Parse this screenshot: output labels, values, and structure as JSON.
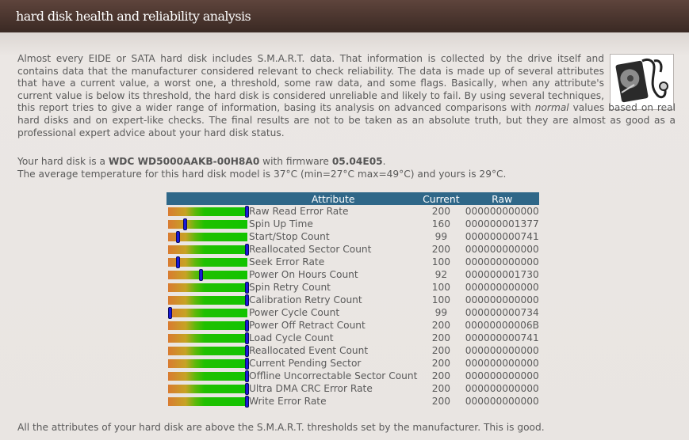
{
  "header": {
    "title": "hard disk health and reliability analysis"
  },
  "intro": {
    "text_before": "Almost every EIDE or SATA hard disk includes S.M.A.R.T. data. That information is collected by the drive itself and contains data that the manufacturer considered relevant to check reliability. The data is made up of several attributes that have a current value, a worst one, a threshold, some raw data, and some flags. Basically, when any attribute's current value is below its threshold, the hard disk is considered unreliable and likely to fail. By using several techniques, this report tries to give a wider range of information, basing its analysis on advanced comparisons with ",
    "emphasis": "normal",
    "text_after": " values based on real hard disks and on expert-like checks. The final results are not to be taken as an absolute truth, but they are almost as good as a professional expert advice about your hard disk status."
  },
  "disk": {
    "line1_prefix": "Your hard disk is a ",
    "model": "WDC WD5000AAKB-00H8A0",
    "line1_mid": " with firmware ",
    "firmware": "05.04E05",
    "line1_suffix": ".",
    "temp_line": "The average temperature for this hard disk model is 37°C (min=27°C max=49°C) and yours is 29°C."
  },
  "table": {
    "headers": {
      "attribute": "Attribute",
      "current": "Current",
      "raw": "Raw"
    },
    "rows": [
      {
        "name": "Raw Read Error Rate",
        "current": "200",
        "raw": "000000000000",
        "level": 1.0
      },
      {
        "name": "Spin Up Time",
        "current": "160",
        "raw": "000000001377",
        "level": 0.2
      },
      {
        "name": "Start/Stop Count",
        "current": "99",
        "raw": "000000000741",
        "level": 0.1
      },
      {
        "name": "Reallocated Sector Count",
        "current": "200",
        "raw": "000000000000",
        "level": 1.0
      },
      {
        "name": "Seek Error Rate",
        "current": "100",
        "raw": "000000000000",
        "level": 0.1
      },
      {
        "name": "Power On Hours Count",
        "current": "92",
        "raw": "000000001730",
        "level": 0.4
      },
      {
        "name": "Spin Retry Count",
        "current": "100",
        "raw": "000000000000",
        "level": 1.0
      },
      {
        "name": "Calibration Retry Count",
        "current": "100",
        "raw": "000000000000",
        "level": 1.0
      },
      {
        "name": "Power Cycle Count",
        "current": "99",
        "raw": "000000000734",
        "level": 0.0
      },
      {
        "name": "Power Off Retract Count",
        "current": "200",
        "raw": "00000000006B",
        "level": 1.0
      },
      {
        "name": "Load Cycle Count",
        "current": "200",
        "raw": "000000000741",
        "level": 1.0
      },
      {
        "name": "Reallocated Event Count",
        "current": "200",
        "raw": "000000000000",
        "level": 1.0
      },
      {
        "name": "Current Pending Sector",
        "current": "200",
        "raw": "000000000000",
        "level": 1.0
      },
      {
        "name": "Offline Uncorrectable Sector Count",
        "current": "200",
        "raw": "000000000000",
        "level": 1.0
      },
      {
        "name": "Ultra DMA CRC Error Rate",
        "current": "200",
        "raw": "000000000000",
        "level": 1.0
      },
      {
        "name": "Write Error Rate",
        "current": "200",
        "raw": "000000000000",
        "level": 1.0
      }
    ]
  },
  "verdict": "All the attributes of your hard disk are above the S.M.A.R.T. thresholds set by the manufacturer. This is good.",
  "icons": {
    "disk_image": "hard-disk-stethoscope-icon"
  },
  "colors": {
    "header_bg": "#3f2c26",
    "table_header": "#2f6788",
    "marker": "#1a1ad8"
  }
}
